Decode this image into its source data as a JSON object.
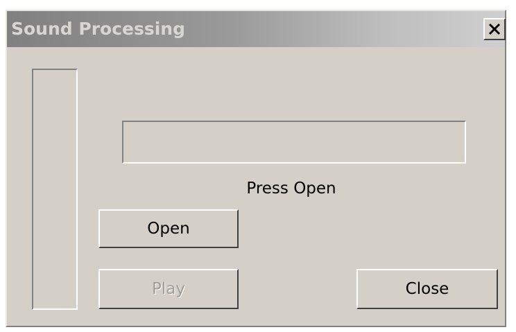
{
  "window": {
    "title": "Sound Processing",
    "close_glyph": "close-icon"
  },
  "progress": {
    "value": 0
  },
  "status": {
    "text": "Press Open"
  },
  "buttons": {
    "open_label": "Open",
    "play_label": "Play",
    "play_enabled": false,
    "close_label": "Close"
  },
  "colors": {
    "face": "#d4d0c8",
    "titlebar_inactive": "#808080",
    "disabled_text": "#a09d98"
  }
}
